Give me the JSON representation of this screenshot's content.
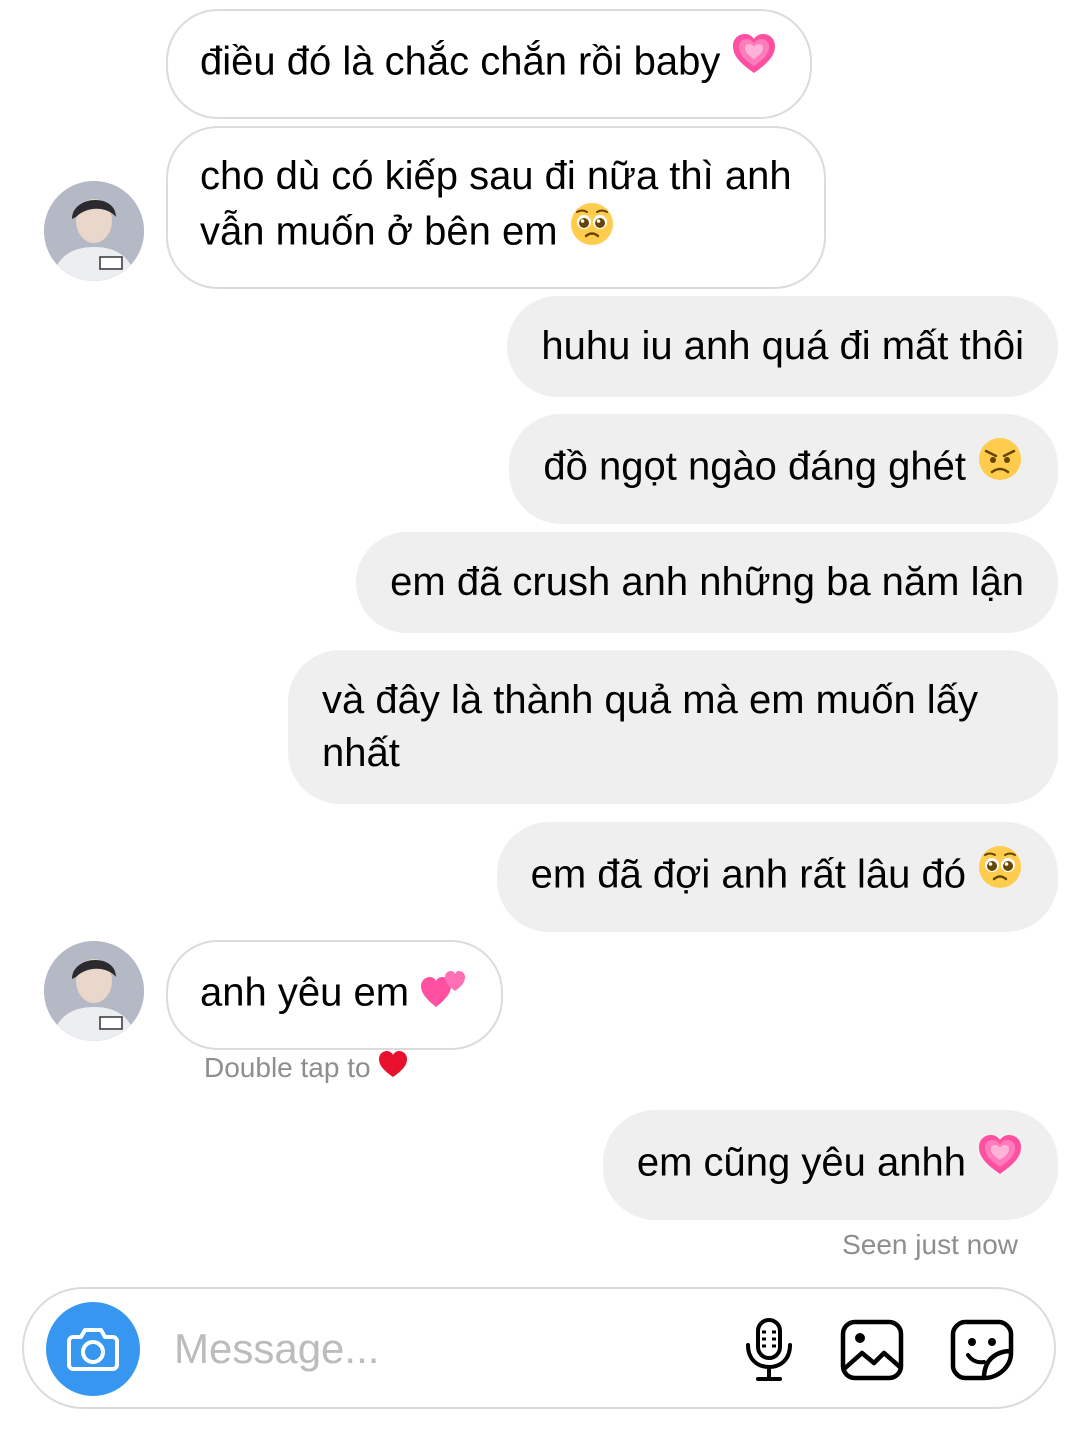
{
  "messages": [
    {
      "id": 1,
      "side": "in",
      "text": "điều đó là chắc chắn rồi baby",
      "emoji": "growing-heart-emoji"
    },
    {
      "id": 2,
      "side": "in",
      "lines": [
        "cho dù có kiếp sau đi nữa thì anh",
        "vẫn muốn ở bên em"
      ],
      "emoji": "pleading-face-emoji"
    },
    {
      "id": 3,
      "side": "out",
      "text": "huhu iu anh quá đi mất thôi"
    },
    {
      "id": 4,
      "side": "out",
      "text": "đồ ngọt ngào đáng ghét",
      "emoji": "angry-face-emoji"
    },
    {
      "id": 5,
      "side": "out",
      "text": "em đã crush anh những ba năm lận"
    },
    {
      "id": 6,
      "side": "out",
      "lines": [
        "và đây là thành quả mà em muốn lấy",
        "nhất"
      ]
    },
    {
      "id": 7,
      "side": "out",
      "text": "em đã đợi anh rất lâu đó",
      "emoji": "pleading-face-emoji"
    },
    {
      "id": 8,
      "side": "in",
      "text": "anh yêu em",
      "emoji": "two-hearts-emoji"
    },
    {
      "id": 9,
      "side": "out",
      "text": "em cũng yêu anhh",
      "emoji": "growing-heart-emoji"
    }
  ],
  "double_tap_hint": "Double tap to",
  "double_tap_icon": "red-heart-icon",
  "seen_status": "Seen just now",
  "composer": {
    "placeholder": "Message...",
    "camera_icon": "camera-icon",
    "mic_icon": "microphone-icon",
    "gallery_icon": "image-icon",
    "sticker_icon": "sticker-icon"
  },
  "colors": {
    "incoming_bubble_border": "#dbdbdb",
    "outgoing_bubble_bg": "#efefef",
    "camera_button": "#3797f0",
    "caption_text": "#8e8e8e",
    "placeholder_text": "#bcbcbc"
  }
}
